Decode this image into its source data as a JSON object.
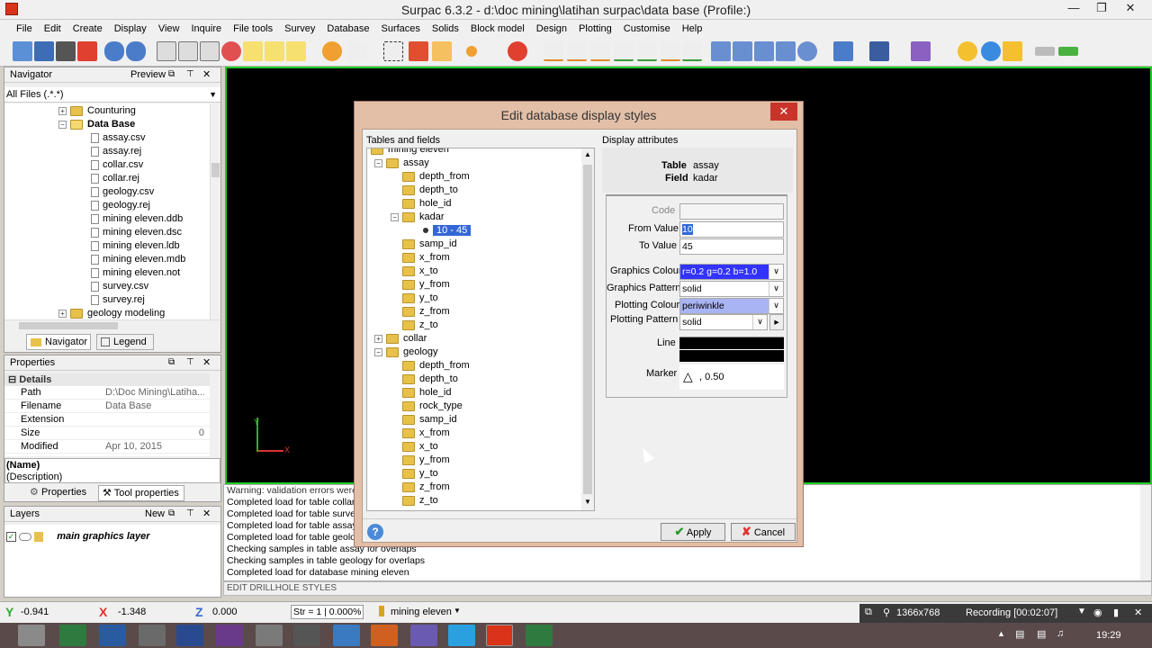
{
  "window": {
    "title": "Surpac 6.3.2 - d:\\doc mining\\latihan surpac\\data base (Profile:)"
  },
  "menu": [
    "File",
    "Edit",
    "Create",
    "Display",
    "View",
    "Inquire",
    "File tools",
    "Survey",
    "Database",
    "Surfaces",
    "Solids",
    "Block model",
    "Design",
    "Plotting",
    "Customise",
    "Help"
  ],
  "navigator": {
    "title": "Navigator",
    "preview_label": "Preview",
    "filter": "All Files (.*.*)",
    "items": [
      {
        "label": "Counturing",
        "type": "folder",
        "indent": 0
      },
      {
        "label": "Data Base",
        "type": "folder-open",
        "indent": 0
      },
      {
        "label": "assay.csv",
        "type": "file",
        "indent": 1
      },
      {
        "label": "assay.rej",
        "type": "file",
        "indent": 1
      },
      {
        "label": "collar.csv",
        "type": "file",
        "indent": 1
      },
      {
        "label": "collar.rej",
        "type": "file",
        "indent": 1
      },
      {
        "label": "geology.csv",
        "type": "file",
        "indent": 1
      },
      {
        "label": "geology.rej",
        "type": "file",
        "indent": 1
      },
      {
        "label": "mining eleven.ddb",
        "type": "file",
        "indent": 1
      },
      {
        "label": "mining eleven.dsc",
        "type": "file",
        "indent": 1
      },
      {
        "label": "mining eleven.ldb",
        "type": "file",
        "indent": 1
      },
      {
        "label": "mining eleven.mdb",
        "type": "file",
        "indent": 1
      },
      {
        "label": "mining eleven.not",
        "type": "file",
        "indent": 1
      },
      {
        "label": "survey.csv",
        "type": "file",
        "indent": 1
      },
      {
        "label": "survey.rej",
        "type": "file",
        "indent": 1
      },
      {
        "label": "geology modeling",
        "type": "folder",
        "indent": 0
      }
    ],
    "tabs": [
      "Navigator",
      "Legend"
    ]
  },
  "properties": {
    "title": "Properties",
    "section": "Details",
    "rows": [
      {
        "key": "Path",
        "value": "D:\\Doc Mining\\Latiha..."
      },
      {
        "key": "Filename",
        "value": "Data Base"
      },
      {
        "key": "Extension",
        "value": ""
      },
      {
        "key": "Size",
        "value": "0"
      },
      {
        "key": "Modified",
        "value": "Apr 10, 2015"
      }
    ],
    "name_label": "(Name)",
    "desc_label": "(Description)",
    "tabs": [
      "Properties",
      "Tool properties"
    ]
  },
  "layers": {
    "title": "Layers",
    "new_label": "New",
    "main_layer": "main graphics layer"
  },
  "messages": [
    "Warning: validation errors were",
    "Completed load for table collar v",
    "Completed load for table survey",
    "Completed load for table assay",
    "Completed load for table geolog",
    "Checking samples in table assay for overlaps",
    "Checking samples in table geology for overlaps",
    "Completed load for database mining eleven"
  ],
  "function_line": "EDIT DRILLHOLE STYLES",
  "axis_labels": {
    "y": "Y",
    "x": "X"
  },
  "status": {
    "y": "-0.941",
    "x": "-1.348",
    "z": "0.000",
    "str": "Str = 1",
    "percent": "0.000%",
    "db": "mining eleven"
  },
  "taskbar": {
    "resolution": "1366x768",
    "recording": "Recording [00:02:07]",
    "clock": "19:29"
  },
  "dialog": {
    "title": "Edit database display styles",
    "tables_label": "Tables and fields",
    "attrs_label": "Display attributes",
    "tree": [
      {
        "label": "mining eleven",
        "level": 0,
        "type": "folder",
        "exp": ""
      },
      {
        "label": "assay",
        "level": 1,
        "type": "folder",
        "exp": "−"
      },
      {
        "label": "depth_from",
        "level": 2,
        "type": "folder",
        "exp": ""
      },
      {
        "label": "depth_to",
        "level": 2,
        "type": "folder",
        "exp": ""
      },
      {
        "label": "hole_id",
        "level": 2,
        "type": "folder",
        "exp": ""
      },
      {
        "label": "kadar",
        "level": 2,
        "type": "folder",
        "exp": "−"
      },
      {
        "label": "10 - 45",
        "level": 3,
        "type": "range",
        "exp": ""
      },
      {
        "label": "samp_id",
        "level": 2,
        "type": "folder",
        "exp": ""
      },
      {
        "label": "x_from",
        "level": 2,
        "type": "folder",
        "exp": ""
      },
      {
        "label": "x_to",
        "level": 2,
        "type": "folder",
        "exp": ""
      },
      {
        "label": "y_from",
        "level": 2,
        "type": "folder",
        "exp": ""
      },
      {
        "label": "y_to",
        "level": 2,
        "type": "folder",
        "exp": ""
      },
      {
        "label": "z_from",
        "level": 2,
        "type": "folder",
        "exp": ""
      },
      {
        "label": "z_to",
        "level": 2,
        "type": "folder",
        "exp": ""
      },
      {
        "label": "collar",
        "level": 1,
        "type": "folder",
        "exp": "+"
      },
      {
        "label": "geology",
        "level": 1,
        "type": "folder",
        "exp": "−"
      },
      {
        "label": "depth_from",
        "level": 2,
        "type": "folder",
        "exp": ""
      },
      {
        "label": "depth_to",
        "level": 2,
        "type": "folder",
        "exp": ""
      },
      {
        "label": "hole_id",
        "level": 2,
        "type": "folder",
        "exp": ""
      },
      {
        "label": "rock_type",
        "level": 2,
        "type": "folder",
        "exp": ""
      },
      {
        "label": "samp_id",
        "level": 2,
        "type": "folder",
        "exp": ""
      },
      {
        "label": "x_from",
        "level": 2,
        "type": "folder",
        "exp": ""
      },
      {
        "label": "x_to",
        "level": 2,
        "type": "folder",
        "exp": ""
      },
      {
        "label": "y_from",
        "level": 2,
        "type": "folder",
        "exp": ""
      },
      {
        "label": "y_to",
        "level": 2,
        "type": "folder",
        "exp": ""
      },
      {
        "label": "z_from",
        "level": 2,
        "type": "folder",
        "exp": ""
      },
      {
        "label": "z_to",
        "level": 2,
        "type": "folder",
        "exp": ""
      }
    ],
    "table_label": "Table",
    "table_value": "assay",
    "field_label": "Field",
    "field_value": "kadar",
    "code_label": "Code",
    "code_value": "",
    "from_label": "From Value",
    "from_value": "10",
    "to_label": "To Value",
    "to_value": "45",
    "gcolour_label": "Graphics Colour",
    "gcolour_value": "r=0.2 g=0.2 b=1.0",
    "gpattern_label": "Graphics Pattern",
    "gpattern_value": "solid",
    "pcolour_label": "Plotting Colour",
    "pcolour_value": "periwinkle",
    "ppattern_label": "Plotting Pattern",
    "ppattern_value": "solid",
    "line_label": "Line",
    "marker_label": "Marker",
    "marker_value": ", 0.50",
    "apply_label": "Apply",
    "cancel_label": "Cancel",
    "colors": {
      "graphics": "#3333ff",
      "plotting": "#a9b4f5"
    }
  }
}
